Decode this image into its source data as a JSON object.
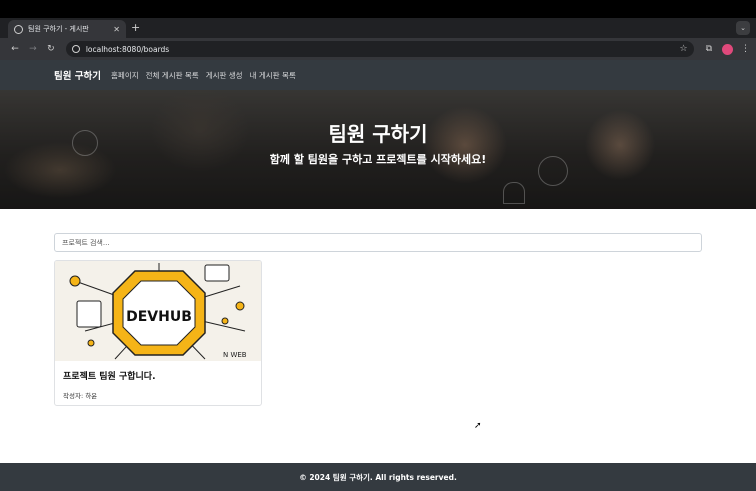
{
  "browser": {
    "tab_title": "팀원 구하기 - 게시판",
    "tab_close": "✕",
    "new_tab": "+",
    "url": "localhost:8080/boards"
  },
  "nav": {
    "brand": "팀원 구하기",
    "links": [
      "홈페이지",
      "전체 게시판 목록",
      "게시판 생성",
      "내 게시판 목록"
    ]
  },
  "hero": {
    "title": "팀원 구하기",
    "subtitle": "함께 할 팀원을 구하고 프로젝트를 시작하세요!"
  },
  "search": {
    "placeholder": "프로젝트 검색..."
  },
  "cards": [
    {
      "image_text": "DEVHUB",
      "image_caption": "N WEB",
      "title": "프로젝트 팀원 구합니다.",
      "author": "작성자: 하윤"
    }
  ],
  "footer": {
    "text": "© 2024 팀원 구하기. All rights reserved."
  },
  "colors": {
    "navbar": "#343a40",
    "accent_yellow": "#f5b417",
    "card_border": "#dfe1e4"
  }
}
